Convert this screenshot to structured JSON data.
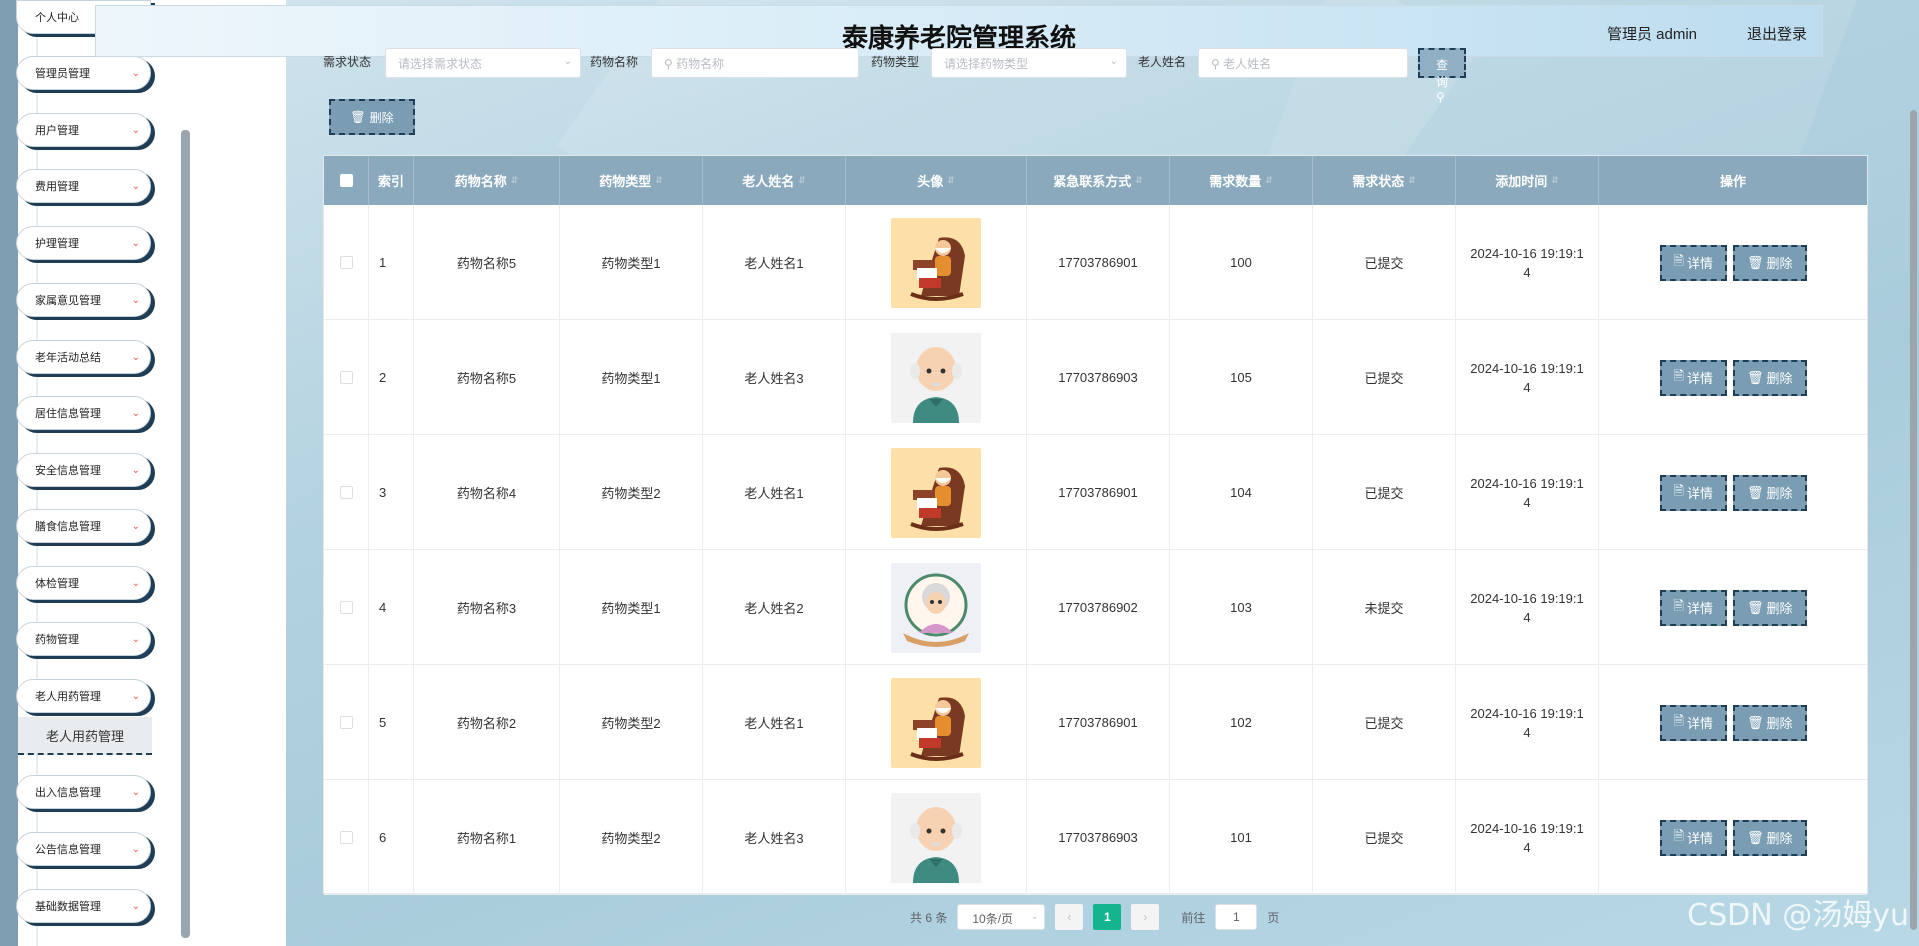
{
  "app_title": "泰康养老院管理系统",
  "header": {
    "user": "管理员 admin",
    "logout": "退出登录"
  },
  "sidebar": {
    "items": [
      {
        "label": "个人中心"
      },
      {
        "label": "管理员管理"
      },
      {
        "label": "用户管理"
      },
      {
        "label": "费用管理"
      },
      {
        "label": "护理管理"
      },
      {
        "label": "家属意见管理"
      },
      {
        "label": "老年活动总结"
      },
      {
        "label": "居住信息管理"
      },
      {
        "label": "安全信息管理"
      },
      {
        "label": "膳食信息管理"
      },
      {
        "label": "体检管理"
      },
      {
        "label": "药物管理"
      },
      {
        "label": "老人用药管理"
      },
      {
        "label": "出入信息管理"
      },
      {
        "label": "公告信息管理"
      },
      {
        "label": "基础数据管理"
      }
    ],
    "active_sub": "老人用药管理"
  },
  "search": {
    "status_label": "需求状态",
    "status_placeholder": "请选择需求状态",
    "drug_name_label": "药物名称",
    "drug_name_placeholder": "药物名称",
    "drug_type_label": "药物类型",
    "drug_type_placeholder": "请选择药物类型",
    "elder_name_label": "老人姓名",
    "elder_name_placeholder": "老人姓名",
    "query_button": "查询"
  },
  "toolbar": {
    "delete_label": "删除"
  },
  "table": {
    "headers": [
      "索引",
      "药物名称",
      "药物类型",
      "老人姓名",
      "头像",
      "紧急联系方式",
      "需求数量",
      "需求状态",
      "添加时间",
      "操作"
    ],
    "rows": [
      {
        "index": "1",
        "drug_name": "药物名称5",
        "drug_type": "药物类型1",
        "elder": "老人姓名1",
        "avatar": "grandpa-rocking-chair",
        "phone": "17703786901",
        "qty": "100",
        "status": "已提交",
        "time": "2024-10-16 19:19:14"
      },
      {
        "index": "2",
        "drug_name": "药物名称5",
        "drug_type": "药物类型1",
        "elder": "老人姓名3",
        "avatar": "grandpa-bald",
        "phone": "17703786903",
        "qty": "105",
        "status": "已提交",
        "time": "2024-10-16 19:19:14"
      },
      {
        "index": "3",
        "drug_name": "药物名称4",
        "drug_type": "药物类型2",
        "elder": "老人姓名1",
        "avatar": "grandpa-rocking-chair",
        "phone": "17703786901",
        "qty": "104",
        "status": "已提交",
        "time": "2024-10-16 19:19:14"
      },
      {
        "index": "4",
        "drug_name": "药物名称3",
        "drug_type": "药物类型1",
        "elder": "老人姓名2",
        "avatar": "grandma-frame",
        "phone": "17703786902",
        "qty": "103",
        "status": "未提交",
        "time": "2024-10-16 19:19:14"
      },
      {
        "index": "5",
        "drug_name": "药物名称2",
        "drug_type": "药物类型2",
        "elder": "老人姓名1",
        "avatar": "grandpa-rocking-chair",
        "phone": "17703786901",
        "qty": "102",
        "status": "已提交",
        "time": "2024-10-16 19:19:14"
      },
      {
        "index": "6",
        "drug_name": "药物名称1",
        "drug_type": "药物类型2",
        "elder": "老人姓名3",
        "avatar": "grandpa-bald",
        "phone": "17703786903",
        "qty": "101",
        "status": "已提交",
        "time": "2024-10-16 19:19:14"
      }
    ],
    "detail_label": "详情",
    "delete_label": "删除"
  },
  "pagination": {
    "total": "共 6 条",
    "page_size": "10条/页",
    "current_page": "1",
    "goto_label": "前往",
    "goto_value": "1",
    "page_suffix": "页"
  },
  "watermark": "CSDN @汤姆yu",
  "colors": {
    "accent": "#7a9db3",
    "dark": "#1f3d54",
    "header": "#8aa9bd",
    "page_active": "#13b58e"
  }
}
